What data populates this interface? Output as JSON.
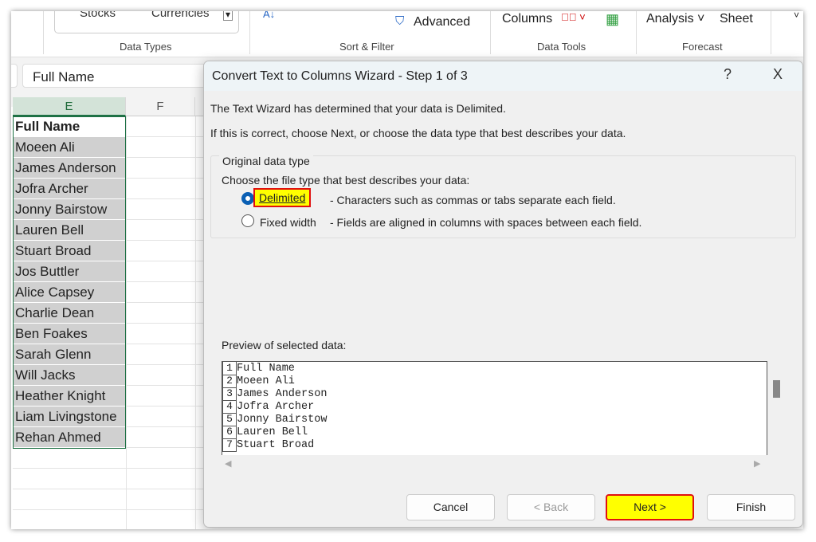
{
  "ribbon": {
    "stocks": "Stocks",
    "currencies": "Currencies",
    "advanced": "Advanced",
    "columns": "Columns",
    "analysis": "Analysis",
    "sheet": "Sheet",
    "groups": [
      "Data Types",
      "Sort & Filter",
      "Data Tools",
      "Forecast"
    ]
  },
  "formula_bar": {
    "value": "Full Name"
  },
  "sheet": {
    "columns": [
      "E",
      "F"
    ],
    "cells": [
      "Full Name",
      "Moeen Ali",
      "James Anderson",
      "Jofra Archer",
      "Jonny Bairstow",
      "Lauren Bell",
      "Stuart Broad",
      "Jos Buttler",
      "Alice Capsey",
      "Charlie Dean",
      "Ben Foakes",
      "Sarah Glenn",
      "Will Jacks",
      "Heather Knight",
      "Liam Livingstone",
      "Rehan Ahmed"
    ]
  },
  "dialog": {
    "title": "Convert Text to Columns Wizard - Step 1 of 3",
    "help": "?",
    "close": "X",
    "line1": "The Text Wizard has determined that your data is Delimited.",
    "line2": "If this is correct, choose Next, or choose the data type that best describes your data.",
    "group_label": "Original data type",
    "choose_label": "Choose the file type that best describes your data:",
    "options": [
      {
        "label": "Delimited",
        "desc": "- Characters such as commas or tabs separate each field.",
        "selected": true
      },
      {
        "label": "Fixed width",
        "desc": "- Fields are aligned in columns with spaces between each field.",
        "selected": false
      }
    ],
    "preview_label": "Preview of selected data:",
    "preview_rows": [
      [
        "1",
        "Full Name"
      ],
      [
        "2",
        "Moeen Ali"
      ],
      [
        "3",
        "James Anderson"
      ],
      [
        "4",
        "Jofra Archer"
      ],
      [
        "5",
        "Jonny Bairstow"
      ],
      [
        "6",
        "Lauren Bell"
      ],
      [
        "7",
        "Stuart Broad"
      ]
    ],
    "buttons": {
      "cancel": "Cancel",
      "back": "< Back",
      "next": "Next >",
      "finish": "Finish"
    },
    "highlight_color": "#ffff00",
    "highlight_border": "#e01010"
  }
}
